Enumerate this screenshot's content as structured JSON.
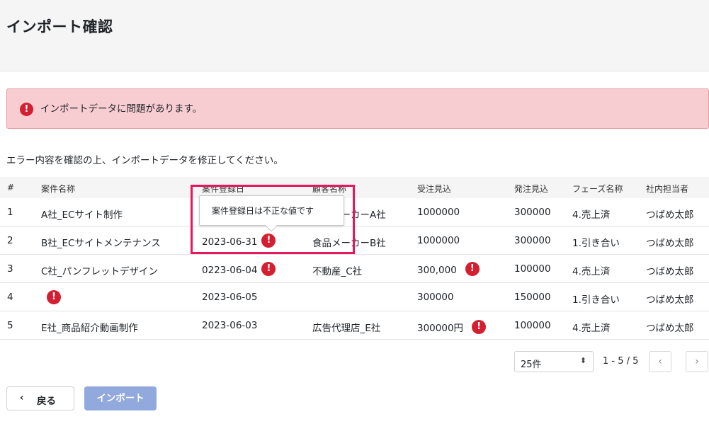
{
  "page": {
    "title": "インポート確認"
  },
  "alert": {
    "message": "インポートデータに問題があります。"
  },
  "instruction": "エラー内容を確認の上、インポートデータを修正してください。",
  "table": {
    "headers": [
      "#",
      "案件名称",
      "案件登録日",
      "顧客名称",
      "受注見込",
      "発注見込",
      "フェーズ名称",
      "社内担当者"
    ],
    "rows": [
      [
        "1",
        "A社_ECサイト制作",
        "",
        "食品メーカーA社",
        "1000000",
        "300000",
        "4.売上済",
        "つばめ太郎"
      ],
      [
        "2",
        "B社_ECサイトメンテナンス",
        "2023-06-31",
        "食品メーカーB社",
        "1000000",
        "300000",
        "1.引き合い",
        "つばめ太郎"
      ],
      [
        "3",
        "C社_パンフレットデザイン",
        "0223-06-04",
        "不動産_C社",
        "300,000",
        "100000",
        "4.売上済",
        "つばめ太郎"
      ],
      [
        "4",
        "",
        "2023-06-05",
        "",
        "300000",
        "150000",
        "1.引き合い",
        "つばめ太郎"
      ],
      [
        "5",
        "E社_商品紹介動画制作",
        "2023-06-03",
        "広告代理店_E社",
        "300000円",
        "100000",
        "4.売上済",
        "つばめ太郎"
      ]
    ],
    "error_icon": "exclamation-circle-icon"
  },
  "tooltip": {
    "text": "案件登録日は不正な値です"
  },
  "pagination": {
    "per_page": "25件",
    "range": "1 - 5 / 5",
    "prev_icon": "chevron-left-icon",
    "next_icon": "chevron-right-icon"
  },
  "actions": {
    "back_label": "戻る",
    "import_label": "インポート"
  },
  "colors": {
    "error": "#d41f31",
    "alert_bg": "#f8cdd2",
    "highlight": "#e8175d",
    "primary_disabled": "#92a9dd"
  }
}
